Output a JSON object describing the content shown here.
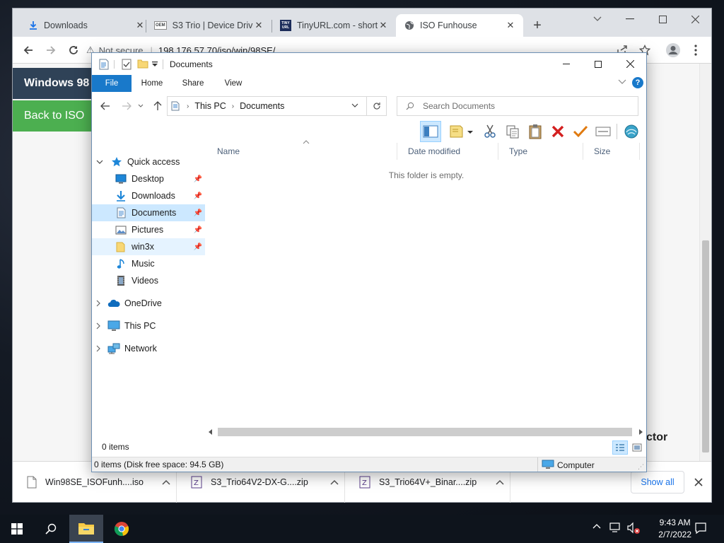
{
  "chrome": {
    "tabs": [
      {
        "label": "Downloads",
        "icon": "download-icon"
      },
      {
        "label": "S3 Trio | Device Drive",
        "icon": "oem-icon",
        "badge": "OEM"
      },
      {
        "label": "TinyURL.com - short",
        "icon": "tinyurl-icon",
        "badge": "TINY URL"
      },
      {
        "label": "ISO Funhouse",
        "icon": "globe-icon",
        "active": true
      }
    ],
    "omnibox": {
      "security": "Not secure",
      "url": "198.176.57.70/iso/win/98SE/"
    },
    "page": {
      "header": "Windows 98",
      "back_button": "Back to ISO",
      "partial_text": "ctor",
      "colors": {
        "blue": "#2f4257",
        "green": "#4caf50"
      }
    },
    "downloads": [
      {
        "name": "Win98SE_ISOFunh....iso"
      },
      {
        "name": "S3_Trio64V2-DX-G....zip"
      },
      {
        "name": "S3_Trio64V+_Binar....zip"
      }
    ],
    "show_all": "Show all"
  },
  "explorer": {
    "title": "Documents",
    "ribbon_tabs": [
      "File",
      "Home",
      "Share",
      "View"
    ],
    "address": {
      "crumb1": "This PC",
      "crumb2": "Documents"
    },
    "search_placeholder": "Search Documents",
    "nav": {
      "quick_access": "Quick access",
      "items": [
        "Desktop",
        "Downloads",
        "Documents",
        "Pictures",
        "win3x",
        "Music",
        "Videos"
      ],
      "onedrive": "OneDrive",
      "this_pc": "This PC",
      "network": "Network"
    },
    "columns": [
      "Name",
      "Date modified",
      "Type",
      "Size"
    ],
    "empty_message": "This folder is empty.",
    "item_count": "0 items",
    "status": {
      "left": "0 items (Disk free space: 94.5 GB)",
      "right": "Computer"
    },
    "accent": "#1979ca"
  },
  "taskbar": {
    "time": "9:43 AM",
    "date": "2/7/2022"
  }
}
